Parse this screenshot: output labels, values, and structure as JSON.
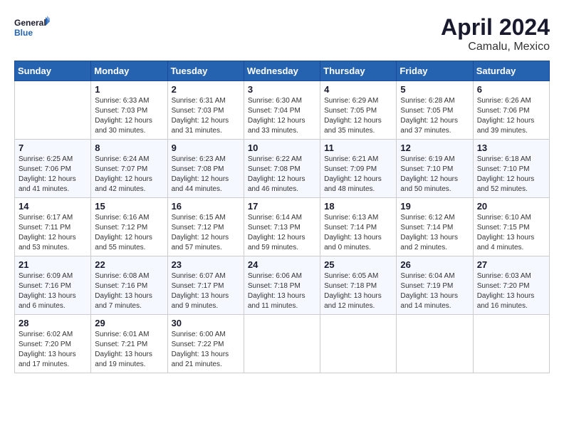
{
  "header": {
    "logo_line1": "General",
    "logo_line2": "Blue",
    "month_title": "April 2024",
    "location": "Camalu, Mexico"
  },
  "days_of_week": [
    "Sunday",
    "Monday",
    "Tuesday",
    "Wednesday",
    "Thursday",
    "Friday",
    "Saturday"
  ],
  "weeks": [
    [
      {
        "num": "",
        "sunrise": "",
        "sunset": "",
        "daylight": ""
      },
      {
        "num": "1",
        "sunrise": "Sunrise: 6:33 AM",
        "sunset": "Sunset: 7:03 PM",
        "daylight": "Daylight: 12 hours and 30 minutes."
      },
      {
        "num": "2",
        "sunrise": "Sunrise: 6:31 AM",
        "sunset": "Sunset: 7:03 PM",
        "daylight": "Daylight: 12 hours and 31 minutes."
      },
      {
        "num": "3",
        "sunrise": "Sunrise: 6:30 AM",
        "sunset": "Sunset: 7:04 PM",
        "daylight": "Daylight: 12 hours and 33 minutes."
      },
      {
        "num": "4",
        "sunrise": "Sunrise: 6:29 AM",
        "sunset": "Sunset: 7:05 PM",
        "daylight": "Daylight: 12 hours and 35 minutes."
      },
      {
        "num": "5",
        "sunrise": "Sunrise: 6:28 AM",
        "sunset": "Sunset: 7:05 PM",
        "daylight": "Daylight: 12 hours and 37 minutes."
      },
      {
        "num": "6",
        "sunrise": "Sunrise: 6:26 AM",
        "sunset": "Sunset: 7:06 PM",
        "daylight": "Daylight: 12 hours and 39 minutes."
      }
    ],
    [
      {
        "num": "7",
        "sunrise": "Sunrise: 6:25 AM",
        "sunset": "Sunset: 7:06 PM",
        "daylight": "Daylight: 12 hours and 41 minutes."
      },
      {
        "num": "8",
        "sunrise": "Sunrise: 6:24 AM",
        "sunset": "Sunset: 7:07 PM",
        "daylight": "Daylight: 12 hours and 42 minutes."
      },
      {
        "num": "9",
        "sunrise": "Sunrise: 6:23 AM",
        "sunset": "Sunset: 7:08 PM",
        "daylight": "Daylight: 12 hours and 44 minutes."
      },
      {
        "num": "10",
        "sunrise": "Sunrise: 6:22 AM",
        "sunset": "Sunset: 7:08 PM",
        "daylight": "Daylight: 12 hours and 46 minutes."
      },
      {
        "num": "11",
        "sunrise": "Sunrise: 6:21 AM",
        "sunset": "Sunset: 7:09 PM",
        "daylight": "Daylight: 12 hours and 48 minutes."
      },
      {
        "num": "12",
        "sunrise": "Sunrise: 6:19 AM",
        "sunset": "Sunset: 7:10 PM",
        "daylight": "Daylight: 12 hours and 50 minutes."
      },
      {
        "num": "13",
        "sunrise": "Sunrise: 6:18 AM",
        "sunset": "Sunset: 7:10 PM",
        "daylight": "Daylight: 12 hours and 52 minutes."
      }
    ],
    [
      {
        "num": "14",
        "sunrise": "Sunrise: 6:17 AM",
        "sunset": "Sunset: 7:11 PM",
        "daylight": "Daylight: 12 hours and 53 minutes."
      },
      {
        "num": "15",
        "sunrise": "Sunrise: 6:16 AM",
        "sunset": "Sunset: 7:12 PM",
        "daylight": "Daylight: 12 hours and 55 minutes."
      },
      {
        "num": "16",
        "sunrise": "Sunrise: 6:15 AM",
        "sunset": "Sunset: 7:12 PM",
        "daylight": "Daylight: 12 hours and 57 minutes."
      },
      {
        "num": "17",
        "sunrise": "Sunrise: 6:14 AM",
        "sunset": "Sunset: 7:13 PM",
        "daylight": "Daylight: 12 hours and 59 minutes."
      },
      {
        "num": "18",
        "sunrise": "Sunrise: 6:13 AM",
        "sunset": "Sunset: 7:14 PM",
        "daylight": "Daylight: 13 hours and 0 minutes."
      },
      {
        "num": "19",
        "sunrise": "Sunrise: 6:12 AM",
        "sunset": "Sunset: 7:14 PM",
        "daylight": "Daylight: 13 hours and 2 minutes."
      },
      {
        "num": "20",
        "sunrise": "Sunrise: 6:10 AM",
        "sunset": "Sunset: 7:15 PM",
        "daylight": "Daylight: 13 hours and 4 minutes."
      }
    ],
    [
      {
        "num": "21",
        "sunrise": "Sunrise: 6:09 AM",
        "sunset": "Sunset: 7:16 PM",
        "daylight": "Daylight: 13 hours and 6 minutes."
      },
      {
        "num": "22",
        "sunrise": "Sunrise: 6:08 AM",
        "sunset": "Sunset: 7:16 PM",
        "daylight": "Daylight: 13 hours and 7 minutes."
      },
      {
        "num": "23",
        "sunrise": "Sunrise: 6:07 AM",
        "sunset": "Sunset: 7:17 PM",
        "daylight": "Daylight: 13 hours and 9 minutes."
      },
      {
        "num": "24",
        "sunrise": "Sunrise: 6:06 AM",
        "sunset": "Sunset: 7:18 PM",
        "daylight": "Daylight: 13 hours and 11 minutes."
      },
      {
        "num": "25",
        "sunrise": "Sunrise: 6:05 AM",
        "sunset": "Sunset: 7:18 PM",
        "daylight": "Daylight: 13 hours and 12 minutes."
      },
      {
        "num": "26",
        "sunrise": "Sunrise: 6:04 AM",
        "sunset": "Sunset: 7:19 PM",
        "daylight": "Daylight: 13 hours and 14 minutes."
      },
      {
        "num": "27",
        "sunrise": "Sunrise: 6:03 AM",
        "sunset": "Sunset: 7:20 PM",
        "daylight": "Daylight: 13 hours and 16 minutes."
      }
    ],
    [
      {
        "num": "28",
        "sunrise": "Sunrise: 6:02 AM",
        "sunset": "Sunset: 7:20 PM",
        "daylight": "Daylight: 13 hours and 17 minutes."
      },
      {
        "num": "29",
        "sunrise": "Sunrise: 6:01 AM",
        "sunset": "Sunset: 7:21 PM",
        "daylight": "Daylight: 13 hours and 19 minutes."
      },
      {
        "num": "30",
        "sunrise": "Sunrise: 6:00 AM",
        "sunset": "Sunset: 7:22 PM",
        "daylight": "Daylight: 13 hours and 21 minutes."
      },
      {
        "num": "",
        "sunrise": "",
        "sunset": "",
        "daylight": ""
      },
      {
        "num": "",
        "sunrise": "",
        "sunset": "",
        "daylight": ""
      },
      {
        "num": "",
        "sunrise": "",
        "sunset": "",
        "daylight": ""
      },
      {
        "num": "",
        "sunrise": "",
        "sunset": "",
        "daylight": ""
      }
    ]
  ]
}
